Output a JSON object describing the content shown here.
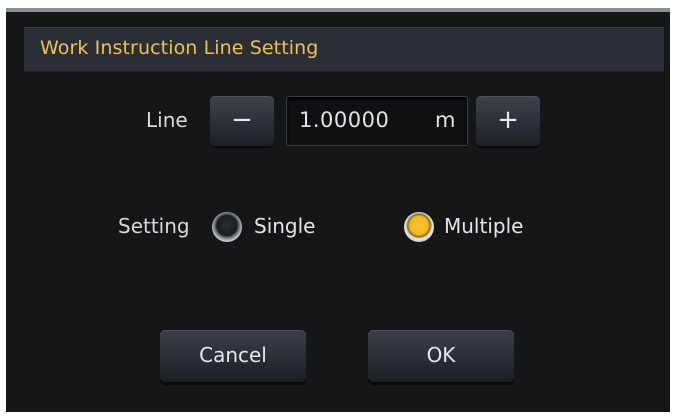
{
  "dialog": {
    "title": "Work Instruction Line Setting"
  },
  "line": {
    "label": "Line",
    "minus_label": "−",
    "plus_label": "+",
    "value": "1.00000",
    "unit": "m"
  },
  "setting": {
    "label": "Setting",
    "options": [
      {
        "label": "Single",
        "selected": false
      },
      {
        "label": "Multiple",
        "selected": true
      }
    ]
  },
  "actions": {
    "cancel_label": "Cancel",
    "ok_label": "OK"
  },
  "colors": {
    "title": "#f1c243",
    "selected_radio": "#f1b81f"
  }
}
